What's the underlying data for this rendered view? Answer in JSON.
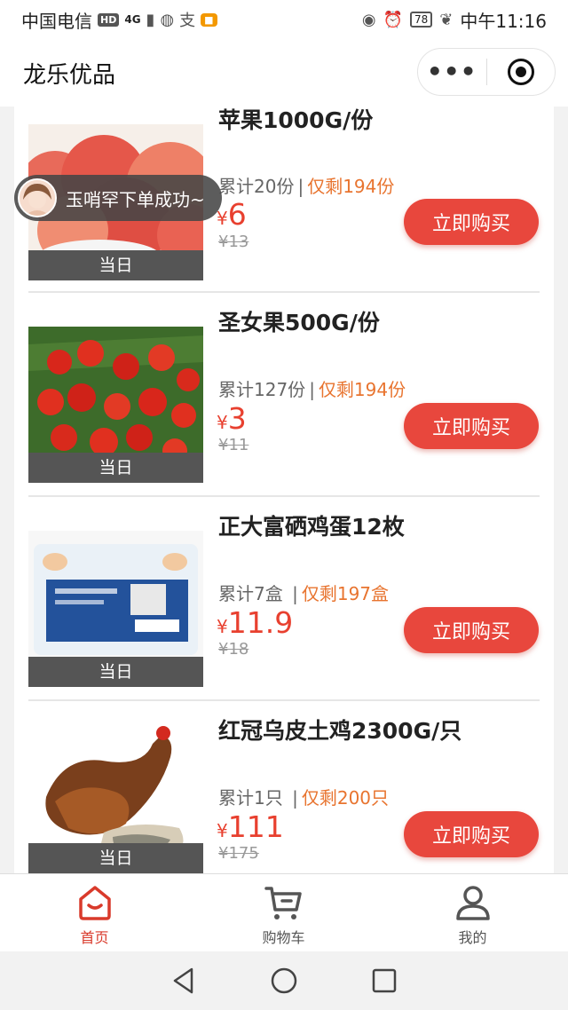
{
  "status_bar": {
    "carrier": "中国电信",
    "hd": "HD",
    "signal": "4G",
    "battery": "78",
    "time": "中午11:16"
  },
  "header": {
    "title": "龙乐优品"
  },
  "toast": {
    "message": "玉哨罕下单成功~"
  },
  "products": [
    {
      "name": "苹果1000G/份",
      "sold": "累计20份",
      "remain": "仅剩194份",
      "currency": "¥",
      "price": "6",
      "old_price": "¥13",
      "tag": "当日",
      "buy_label": "立即购买"
    },
    {
      "name": "圣女果500G/份",
      "sold": "累计127份",
      "remain": "仅剩194份",
      "currency": "¥",
      "price": "3",
      "old_price": "¥11",
      "tag": "当日",
      "buy_label": "立即购买"
    },
    {
      "name": "正大富硒鸡蛋12枚",
      "sold": "累计7盒",
      "remain": "仅剩197盒",
      "currency": "¥",
      "price": "11.9",
      "old_price": "¥18",
      "tag": "当日",
      "buy_label": "立即购买"
    },
    {
      "name": "红冠乌皮土鸡2300G/只",
      "sold": "累计1只",
      "remain": "仅剩200只",
      "currency": "¥",
      "price": "111",
      "old_price": "¥175",
      "tag": "当日",
      "buy_label": "立即购买"
    }
  ],
  "tabbar": {
    "home": "首页",
    "cart": "购物车",
    "mine": "我的"
  },
  "colors": {
    "accent": "#e8473d",
    "price": "#e8402f",
    "remain": "#e8742f"
  }
}
